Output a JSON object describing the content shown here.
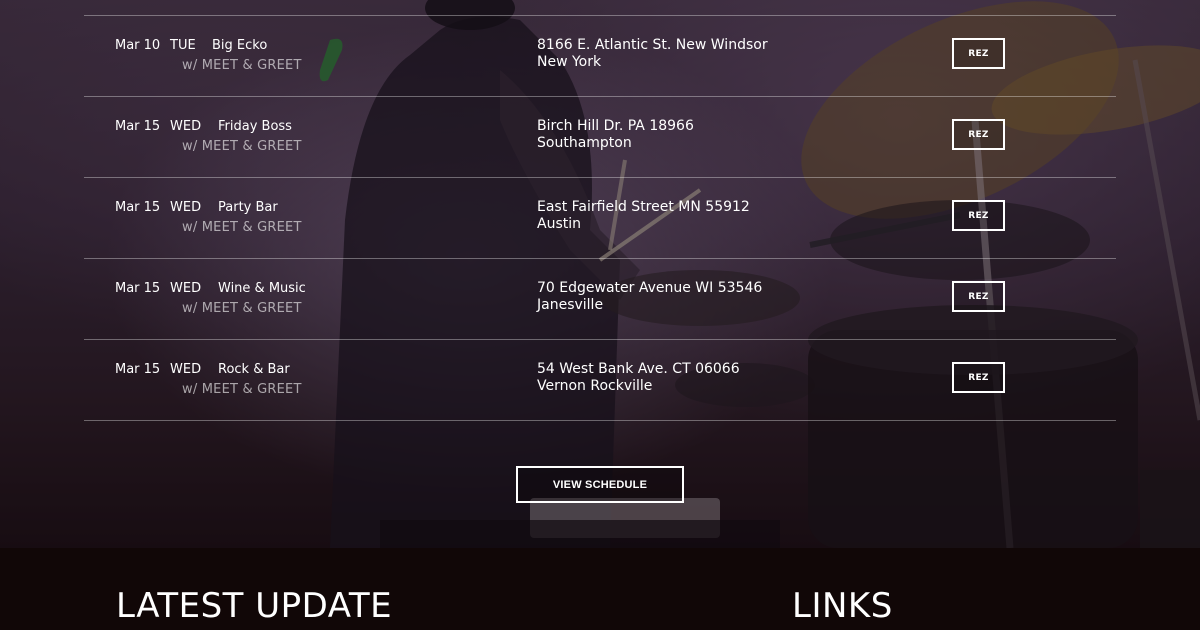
{
  "tour": {
    "rows": [
      {
        "date": "Mar 10",
        "day": "TUE",
        "venue": "Big Ecko",
        "extra": "w/ MEET & GREET",
        "address_line1": "8166 E. Atlantic St. New Windsor",
        "address_line2": "New York",
        "button": "REZ"
      },
      {
        "date": "Mar 15",
        "day": "WED",
        "venue": "Friday Boss",
        "extra": "w/ MEET & GREET",
        "address_line1": "Birch Hill Dr. PA 18966",
        "address_line2": "Southampton",
        "button": "REZ"
      },
      {
        "date": "Mar 15",
        "day": "WED",
        "venue": "Party Bar",
        "extra": "w/ MEET & GREET",
        "address_line1": "East Fairfield Street MN 55912",
        "address_line2": "Austin",
        "button": "REZ"
      },
      {
        "date": "Mar 15",
        "day": "WED",
        "venue": "Wine & Music",
        "extra": "w/ MEET & GREET",
        "address_line1": "70 Edgewater Avenue WI 53546",
        "address_line2": "Janesville",
        "button": "REZ"
      },
      {
        "date": "Mar 15",
        "day": "WED",
        "venue": "Rock & Bar",
        "extra": "w/ MEET & GREET",
        "address_line1": "54 West Bank Ave. CT 06066",
        "address_line2": "Vernon Rockville",
        "button": "REZ"
      }
    ],
    "view_schedule_label": "VIEW SCHEDULE"
  },
  "footer": {
    "latest_update_heading": "LATEST UPDATE",
    "links_heading": "LINKS"
  },
  "colors": {
    "footer_bg": "#110707",
    "text": "#ffffff",
    "muted_text": "#b9b1b6"
  }
}
